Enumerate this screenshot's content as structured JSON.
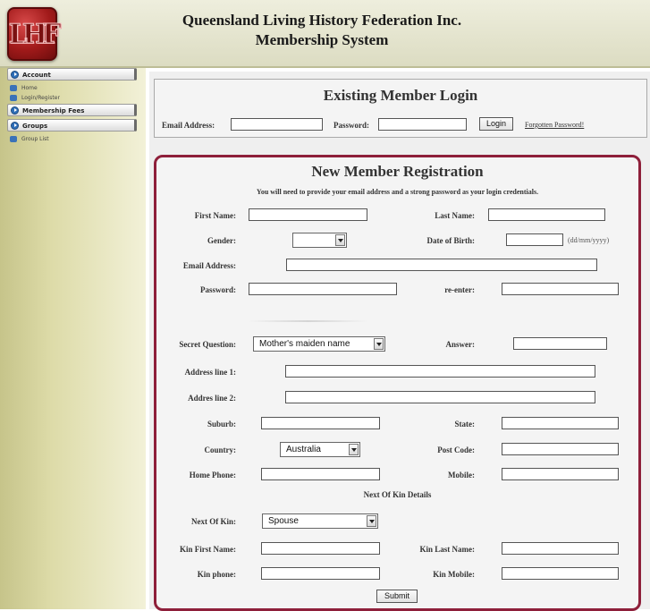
{
  "header": {
    "title_line1": "Queensland Living History Federation Inc.",
    "title_line2": "Membership System",
    "logo_text": "LHF"
  },
  "sidebar": {
    "sections": [
      {
        "label": "Account",
        "items": [
          {
            "label": "Home"
          },
          {
            "label": "Login/Register"
          }
        ]
      },
      {
        "label": "Membership Fees",
        "items": []
      },
      {
        "label": "Groups",
        "items": [
          {
            "label": "Group List"
          }
        ]
      }
    ]
  },
  "login": {
    "title": "Existing Member Login",
    "email_label": "Email Address:",
    "email_value": "",
    "password_label": "Password:",
    "password_value": "",
    "login_button": "Login",
    "forgot_link": "Forgotten Password!"
  },
  "registration": {
    "title": "New Member Registration",
    "note": "You will need to provide your email address and a strong password as your login credentials.",
    "first_name_label": "First Name:",
    "last_name_label": "Last Name:",
    "gender_label": "Gender:",
    "gender_value": "",
    "dob_label": "Date of Birth:",
    "dob_hint": "(dd/mm/yyyy)",
    "email_label": "Email Address:",
    "password_label": "Password:",
    "reenter_label": "re-enter:",
    "secret_question_label": "Secret Question:",
    "secret_question_value": "Mother's maiden name",
    "answer_label": "Answer:",
    "address1_label": "Address line 1:",
    "address2_label": "Addres line 2:",
    "suburb_label": "Suburb:",
    "state_label": "State:",
    "country_label": "Country:",
    "country_value": "Australia",
    "postcode_label": "Post Code:",
    "home_phone_label": "Home Phone:",
    "mobile_label": "Mobile:",
    "next_of_kin_heading": "Next Of Kin Details",
    "next_of_kin_label": "Next Of Kin:",
    "next_of_kin_value": "Spouse",
    "kin_first_name_label": "Kin First Name:",
    "kin_last_name_label": "Kin Last Name:",
    "kin_phone_label": "Kin phone:",
    "kin_mobile_label": "Kin Mobile:",
    "submit_button": "Submit"
  },
  "colors": {
    "accent": "#8e1f3a",
    "sidebar_bg": "#dddba8",
    "nav_bullet": "#2f6fb8"
  }
}
